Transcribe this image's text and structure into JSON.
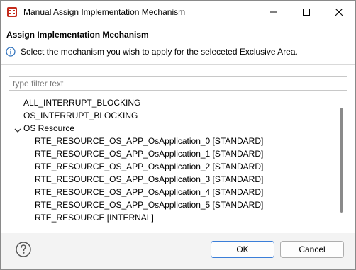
{
  "window": {
    "title": "Manual Assign Implementation Mechanism"
  },
  "header": {
    "title": "Assign Implementation Mechanism",
    "message": "Select the mechanism you wish to apply for the seleceted Exclusive Area."
  },
  "filter": {
    "placeholder": "type filter text",
    "value": ""
  },
  "tree": {
    "items": [
      {
        "label": "ALL_INTERRUPT_BLOCKING"
      },
      {
        "label": "OS_INTERRUPT_BLOCKING"
      },
      {
        "label": "OS Resource",
        "expanded": true
      },
      {
        "label": "RTE_RESOURCE_OS_APP_OsApplication_0 [STANDARD]"
      },
      {
        "label": "RTE_RESOURCE_OS_APP_OsApplication_1 [STANDARD]"
      },
      {
        "label": "RTE_RESOURCE_OS_APP_OsApplication_2 [STANDARD]"
      },
      {
        "label": "RTE_RESOURCE_OS_APP_OsApplication_3 [STANDARD]"
      },
      {
        "label": "RTE_RESOURCE_OS_APP_OsApplication_4 [STANDARD]"
      },
      {
        "label": "RTE_RESOURCE_OS_APP_OsApplication_5 [STANDARD]"
      },
      {
        "label": "RTE_RESOURCE [INTERNAL]"
      }
    ]
  },
  "buttons": {
    "ok": "OK",
    "cancel": "Cancel"
  },
  "icons": {
    "app": "app-icon",
    "minimize": "minimize-icon",
    "maximize": "maximize-icon",
    "close": "close-icon",
    "info": "info-icon",
    "expand": "chevron-down-icon",
    "help": "help-icon"
  },
  "colors": {
    "info_blue": "#2a6ebb",
    "ok_border": "#3b7ed8",
    "app_icon_red": "#c42b1c"
  }
}
